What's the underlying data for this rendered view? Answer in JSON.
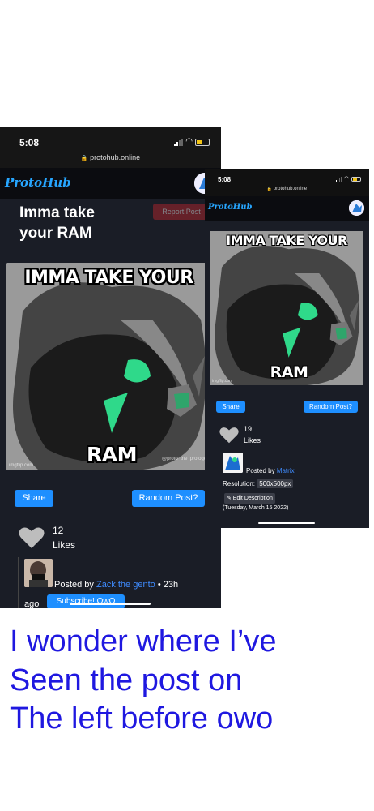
{
  "left_phone": {
    "status_time": "5:08",
    "url": "protohub.online",
    "logo": "ProtoHub",
    "post_title": "Imma take your RAM",
    "report_label": "Report Post",
    "meme_top": "IMMA TAKE YOUR",
    "meme_bottom": "RAM",
    "watermark_left": "imgflip.com",
    "watermark_right": "@proto_the_protogen",
    "share_label": "Share",
    "random_label": "Random Post?",
    "likes_count": "12",
    "likes_label": "Likes",
    "posted_by_prefix": "Posted by",
    "author": "Zack the gento",
    "time_ago": "• 23h",
    "ago": "ago",
    "subscribe_label": "Subscribe! OwO"
  },
  "right_phone": {
    "status_time": "5:08",
    "url": "protohub.online",
    "logo": "ProtoHub",
    "meme_top": "IMMA TAKE YOUR",
    "meme_bottom": "RAM",
    "watermark_left": "imgflip.com",
    "share_label": "Share",
    "random_label": "Random Post?",
    "likes_count": "19",
    "likes_label": "Likes",
    "posted_by_prefix": "Posted by",
    "author": "Matrix",
    "resolution_label": "Resolution:",
    "resolution_value": "500x500px",
    "edit_label": "✎ Edit Description",
    "date": "(Tuesday, March 15 2022)"
  },
  "caption": {
    "line1": "I wonder where I’ve",
    "line2": "Seen the post on",
    "line3": "The left before owo"
  },
  "colors": {
    "accent": "#1e8fff",
    "link": "#3f8cff",
    "caption": "#1f18e0",
    "background": "#1a1d26"
  },
  "icons": [
    "lock-icon",
    "signal-icon",
    "wifi-icon",
    "battery-icon",
    "heart-icon",
    "pencil-icon"
  ]
}
